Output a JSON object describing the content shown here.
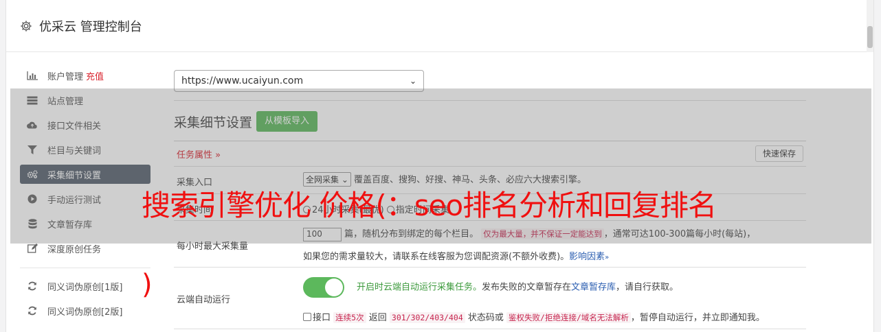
{
  "app": {
    "title": "优采云 管理控制台",
    "gear_icon": "gear-icon"
  },
  "sidebar": {
    "items": [
      {
        "label": "账户管理",
        "extra": "充值",
        "icon": "bar-chart-icon"
      },
      {
        "label": "站点管理",
        "icon": "server-icon"
      },
      {
        "label": "接口文件相关",
        "icon": "cloud-upload-icon"
      },
      {
        "label": "栏目与关键词",
        "icon": "filter-icon"
      },
      {
        "label": "采集细节设置",
        "icon": "gears-icon",
        "active": true
      },
      {
        "label": "手动运行测试",
        "icon": "play-circle-icon"
      },
      {
        "label": "文章暂存库",
        "icon": "database-icon"
      },
      {
        "label": "深度原创任务",
        "icon": "edit-icon"
      }
    ],
    "items2": [
      {
        "label": "同义词伪原创[1版]",
        "icon": "refresh-icon"
      },
      {
        "label": "同义词伪原创[2版]",
        "icon": "refresh-icon"
      }
    ]
  },
  "main": {
    "site_select": "https://www.ucaiyun.com",
    "section_title": "采集细节设置",
    "import_button": "从模板导入",
    "task_attr": "任务属性 »",
    "quick_save": "快速保存",
    "rows": {
      "entry": {
        "label": "采集入口",
        "select": "全网采集",
        "desc": "覆盖百度、搜狗、好搜、神马、头条、必应六大搜索引擎。"
      },
      "time": {
        "label": "采集时间",
        "opt1": "24小时采集(最优)",
        "opt2": "指定时间采集"
      },
      "max": {
        "label": "每小时最大采集量",
        "value": "100",
        "text1": "篇，随机分布到绑定的每个栏目。",
        "code": "仅为最大量，并不保证一定能达到",
        "text2": "，通常可达100-300篇每小时(每站)，",
        "text3": "如果您的需求量较大，请联系在线客服为您调配资源(不额外收费)。",
        "link": "影响因素",
        "link_arrow": "»"
      },
      "cloud": {
        "label": "云端自动运行",
        "green": "开启时云端自动运行采集任务。",
        "text1": "发布失败的文章暂存在",
        "link": "文章暂存库",
        "text2": "，请自行获取。",
        "chk_label": "接口",
        "code1": "连续5次",
        "text3": "返回",
        "code2": "301/302/403/404",
        "text4": "状态码或",
        "code3": "鉴权失败/拒绝连接/域名无法解析",
        "text5": "，暂停自动运行，并立即通知我。"
      }
    }
  },
  "overlay": {
    "banner": "搜索引擎优化 价格(：seo排名分析和回复排名",
    "paren": ")"
  }
}
